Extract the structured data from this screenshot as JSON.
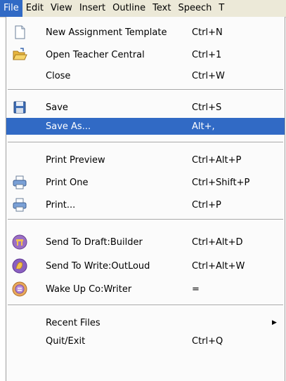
{
  "menubar": {
    "items": [
      "File",
      "Edit",
      "View",
      "Insert",
      "Outline",
      "Text",
      "Speech",
      "T"
    ]
  },
  "file_menu": {
    "items": [
      {
        "label": "New Assignment Template",
        "shortcut": "Ctrl+N",
        "icon": "new-document-icon"
      },
      {
        "label": "Open Teacher Central",
        "shortcut": "Ctrl+1",
        "icon": "open-folder-icon"
      },
      {
        "label": "Close",
        "shortcut": "Ctrl+W",
        "icon": ""
      },
      {
        "label": "Save",
        "shortcut": "Ctrl+S",
        "icon": "floppy-disk-icon"
      },
      {
        "label": "Save As...",
        "shortcut": "Alt+,",
        "icon": "",
        "highlighted": true
      },
      {
        "label": "Print Preview",
        "shortcut": "Ctrl+Alt+P",
        "icon": ""
      },
      {
        "label": "Print One",
        "shortcut": "Ctrl+Shift+P",
        "icon": "printer-icon"
      },
      {
        "label": "Print...",
        "shortcut": "Ctrl+P",
        "icon": "printer-icon"
      },
      {
        "label": "Send To Draft:Builder",
        "shortcut": "Ctrl+Alt+D",
        "icon": "draft-builder-icon"
      },
      {
        "label": "Send To Write:OutLoud",
        "shortcut": "Ctrl+Alt+W",
        "icon": "write-outloud-icon"
      },
      {
        "label": "Wake Up Co:Writer",
        "shortcut": "=",
        "icon": "co-writer-icon"
      },
      {
        "label": "Recent Files",
        "shortcut": "",
        "icon": "",
        "submenu": true
      },
      {
        "label": "Quit/Exit",
        "shortcut": "Ctrl+Q",
        "icon": ""
      }
    ]
  },
  "colors": {
    "highlight": "#316ac5",
    "menubar_bg": "#ece9d8",
    "menu_bg": "#fbfbfb"
  }
}
